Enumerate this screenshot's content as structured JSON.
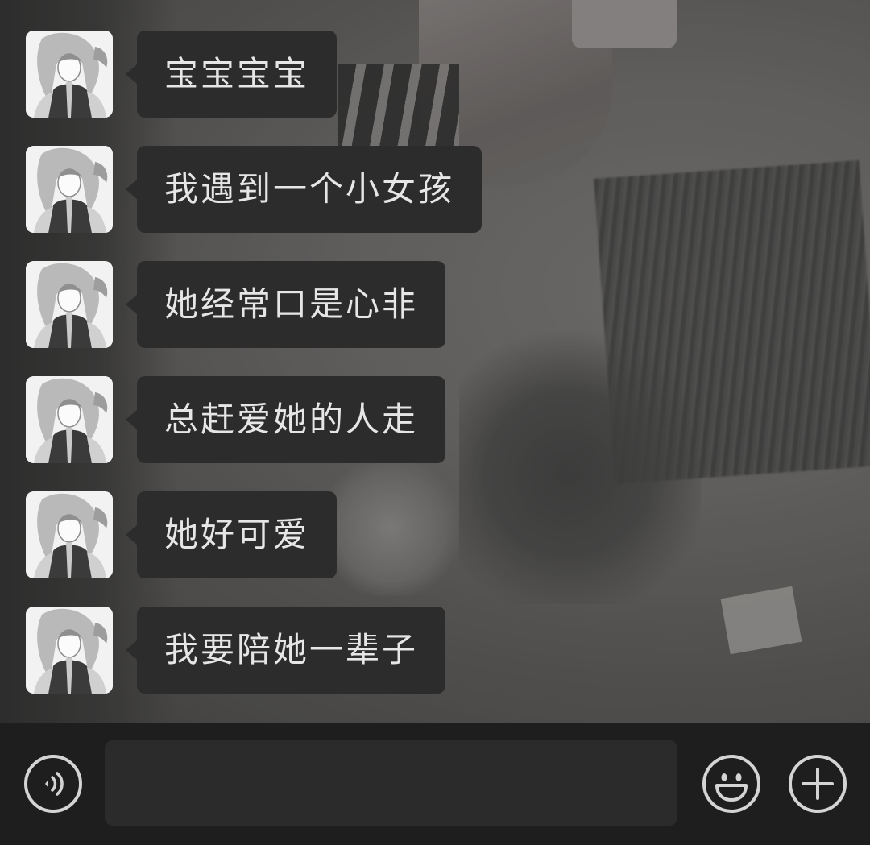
{
  "conversation": {
    "messages": [
      {
        "sender": "other",
        "text": "宝宝宝宝"
      },
      {
        "sender": "other",
        "text": "我遇到一个小女孩"
      },
      {
        "sender": "other",
        "text": "她经常口是心非"
      },
      {
        "sender": "other",
        "text": "总赶爱她的人走"
      },
      {
        "sender": "other",
        "text": "她好可爱"
      },
      {
        "sender": "other",
        "text": "我要陪她一辈子"
      }
    ]
  },
  "input_bar": {
    "message_value": "",
    "icons": {
      "voice": "voice-icon",
      "emoji": "emoji-icon",
      "add": "plus-icon"
    }
  },
  "colors": {
    "bubble_bg": "#2c2c2c",
    "bubble_text": "#e6e6e6",
    "input_bar_bg": "#1e1e1e",
    "input_field_bg": "#2b2b2b",
    "icon_stroke": "#d4d4d4"
  }
}
